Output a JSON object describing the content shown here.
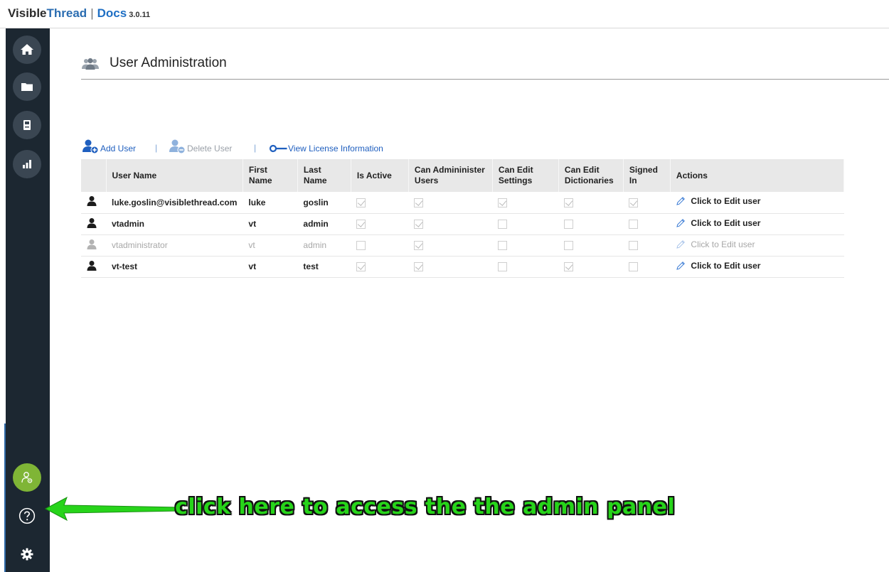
{
  "header": {
    "brand_part1": "Visible",
    "brand_part2": "Thread",
    "separator": "|",
    "product": "Docs",
    "version": "3.0.11"
  },
  "sidebar": {
    "items": [
      {
        "name": "home",
        "icon": "home-icon"
      },
      {
        "name": "documents",
        "icon": "folder-icon"
      },
      {
        "name": "library",
        "icon": "book-icon"
      },
      {
        "name": "reports",
        "icon": "bar-chart-icon"
      },
      {
        "name": "admin",
        "icon": "user-admin-icon",
        "active": true
      },
      {
        "name": "help",
        "icon": "help-icon"
      },
      {
        "name": "settings",
        "icon": "gear-icon"
      }
    ],
    "accent_color": "#7fb536",
    "background_color": "#1c2731"
  },
  "main": {
    "page_title": "User Administration",
    "toolbar": {
      "add_user": "Add User",
      "delete_user": "Delete User",
      "view_license": "View License Information",
      "separator": "|"
    },
    "table": {
      "columns": [
        "User Name",
        "First Name",
        "Last Name",
        "Is Active",
        "Can Admininister Users",
        "Can Edit Settings",
        "Can Edit Dictionaries",
        "Signed In",
        "Actions"
      ],
      "rows": [
        {
          "user_name": "luke.goslin@visiblethread.com",
          "first_name": "luke",
          "last_name": "goslin",
          "is_active": true,
          "can_admin": true,
          "can_edit_settings": true,
          "can_edit_dictionaries": true,
          "signed_in": true,
          "action": "Click to Edit user",
          "enabled": true
        },
        {
          "user_name": "vtadmin",
          "first_name": "vt",
          "last_name": "admin",
          "is_active": true,
          "can_admin": true,
          "can_edit_settings": false,
          "can_edit_dictionaries": false,
          "signed_in": false,
          "action": "Click to Edit user",
          "enabled": true
        },
        {
          "user_name": "vtadministrator",
          "first_name": "vt",
          "last_name": "admin",
          "is_active": false,
          "can_admin": true,
          "can_edit_settings": false,
          "can_edit_dictionaries": false,
          "signed_in": false,
          "action": "Click to Edit user",
          "enabled": false
        },
        {
          "user_name": "vt-test",
          "first_name": "vt",
          "last_name": "test",
          "is_active": true,
          "can_admin": true,
          "can_edit_settings": false,
          "can_edit_dictionaries": true,
          "signed_in": false,
          "action": "Click to Edit user",
          "enabled": true
        }
      ]
    }
  },
  "annotation": {
    "text": "click here to access the the admin panel",
    "color": "#27d41a"
  }
}
